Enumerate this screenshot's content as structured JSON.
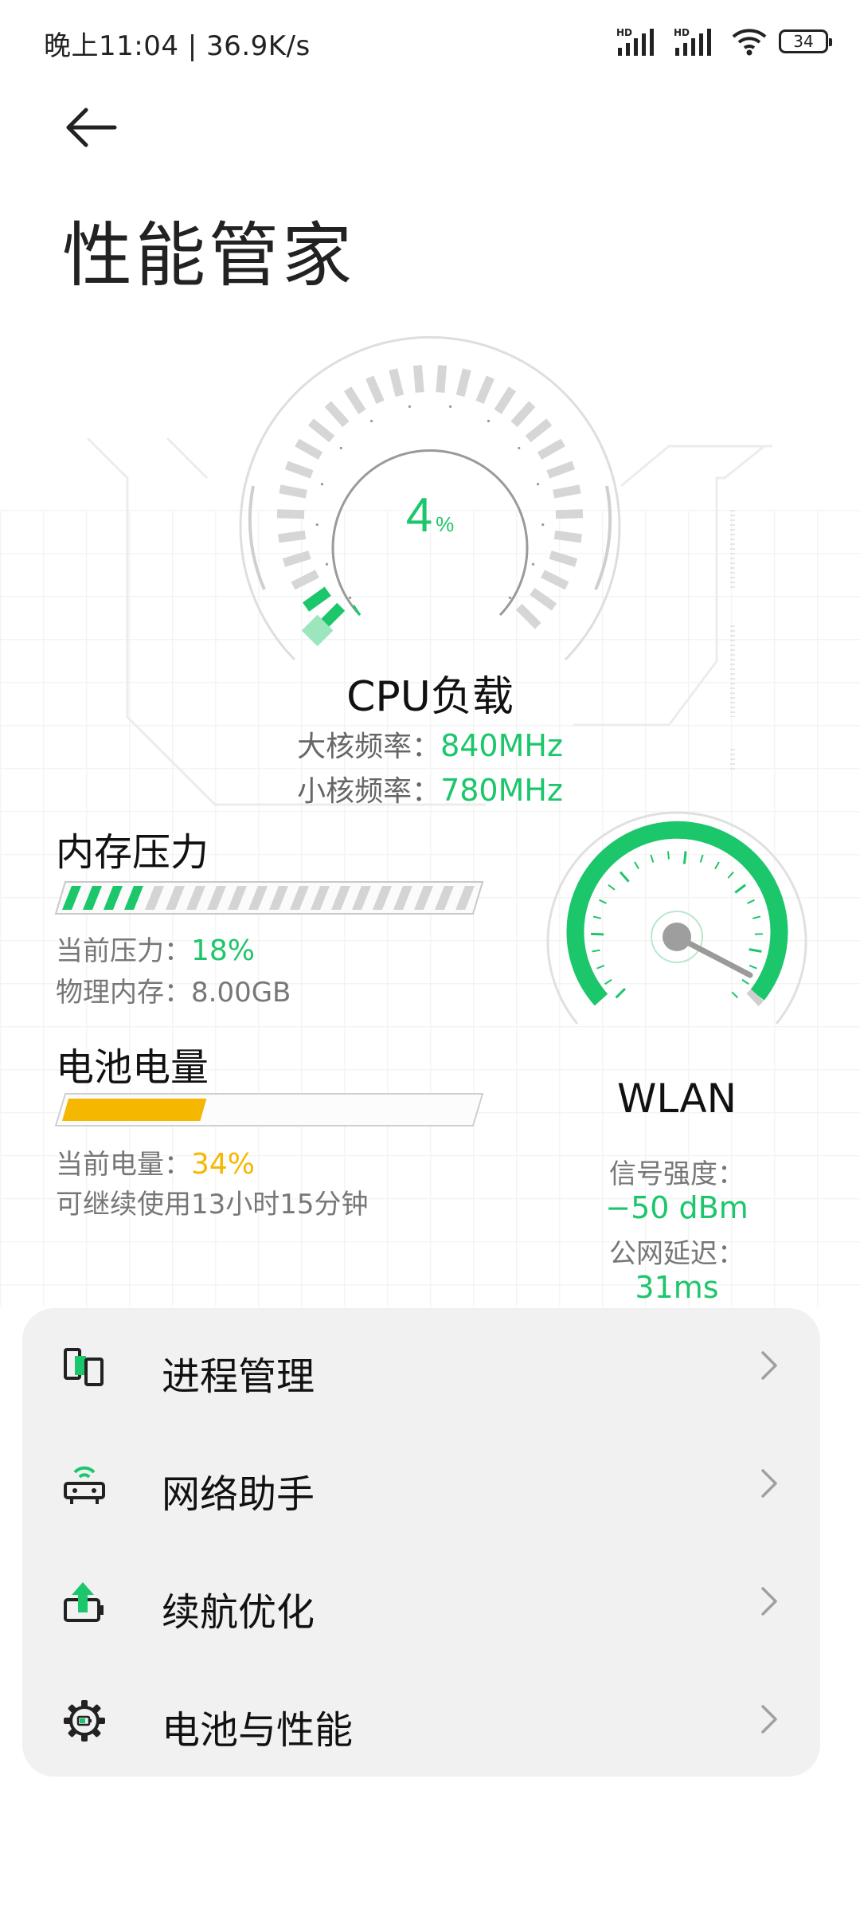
{
  "status_bar": {
    "time_speed": "晚上11:04 | 36.9K/s",
    "signal1_label": "HD",
    "signal2_label": "HD",
    "battery": "34"
  },
  "header": {
    "back_icon": "back-arrow-icon",
    "title": "性能管家"
  },
  "cpu": {
    "load_value": "4",
    "load_unit": "%",
    "title": "CPU负载",
    "big_core_label": "大核频率：",
    "big_core_value": "840MHz",
    "little_core_label": "小核频率：",
    "little_core_value": "780MHz",
    "load_fraction": 0.04
  },
  "memory": {
    "title": "内存压力",
    "pressure_label": "当前压力：",
    "pressure_value": "18%",
    "physical_label": "物理内存：",
    "physical_value": "8.00GB",
    "pressure_fraction": 0.18
  },
  "battery": {
    "title": "电池电量",
    "level_label": "当前电量：",
    "level_value": "34%",
    "remaining": "可继续使用13小时15分钟",
    "level_fraction": 0.34
  },
  "wlan": {
    "title": "WLAN",
    "signal_label": "信号强度：",
    "signal_value": "−50 dBm",
    "latency_label": "公网延迟：",
    "latency_value": "31ms"
  },
  "menu": {
    "items": [
      {
        "label": "进程管理",
        "icon": "process-manage-icon"
      },
      {
        "label": "网络助手",
        "icon": "network-router-icon"
      },
      {
        "label": "续航优化",
        "icon": "battery-boost-icon"
      },
      {
        "label": "电池与性能",
        "icon": "settings-gear-icon"
      }
    ]
  },
  "colors": {
    "accent_green": "#1cc66b",
    "battery_yellow": "#f5b700",
    "card_bg": "#f1f1f1"
  }
}
